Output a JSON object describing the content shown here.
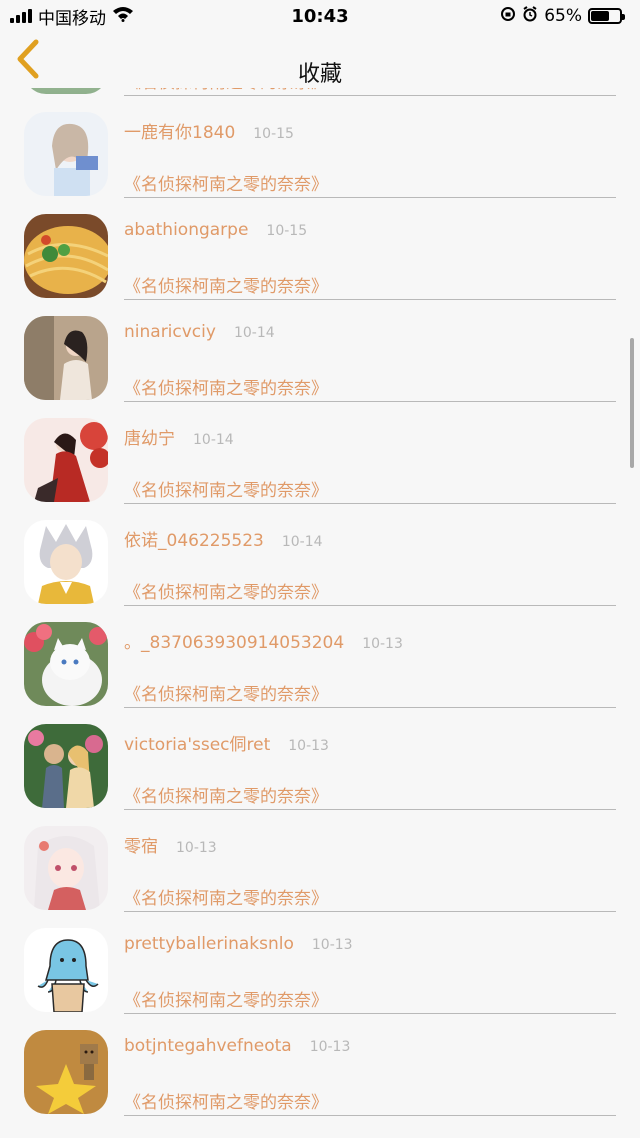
{
  "status_bar": {
    "carrier": "中国移动",
    "time": "10:43",
    "battery": "65%",
    "battery_level": 0.65,
    "icons": [
      "signal-icon",
      "wifi-icon",
      "rotation-lock-icon",
      "alarm-icon",
      "battery-icon"
    ]
  },
  "nav": {
    "title": "收藏",
    "back_icon": "chevron-left-icon",
    "accent": "#e0a020"
  },
  "colors": {
    "link": "#e09a68",
    "date": "#b8b8b8"
  },
  "items": [
    {
      "name": "《名侦探柯南之零的奈奈》",
      "date": "",
      "title": "《名侦探柯南之零的奈奈》"
    },
    {
      "name": "一鹿有你1840",
      "date": "10-15",
      "title": "《名侦探柯南之零的奈奈》"
    },
    {
      "name": "abathiongarpe",
      "date": "10-15",
      "title": "《名侦探柯南之零的奈奈》"
    },
    {
      "name": "ninaricvciy",
      "date": "10-14",
      "title": "《名侦探柯南之零的奈奈》"
    },
    {
      "name": "唐幼宁",
      "date": "10-14",
      "title": "《名侦探柯南之零的奈奈》"
    },
    {
      "name": "依诺_046225523",
      "date": "10-14",
      "title": "《名侦探柯南之零的奈奈》"
    },
    {
      "name": "。_837063930914053204",
      "date": "10-13",
      "title": "《名侦探柯南之零的奈奈》"
    },
    {
      "name": "victoria'ssec侗ret",
      "date": "10-13",
      "title": "《名侦探柯南之零的奈奈》"
    },
    {
      "name": "零宿",
      "date": "10-13",
      "title": "《名侦探柯南之零的奈奈》"
    },
    {
      "name": "prettyballerinaksnlo",
      "date": "10-13",
      "title": "《名侦探柯南之零的奈奈》"
    },
    {
      "name": "botjntegahvefneota",
      "date": "10-13",
      "title": "《名侦探柯南之零的奈奈》"
    }
  ]
}
